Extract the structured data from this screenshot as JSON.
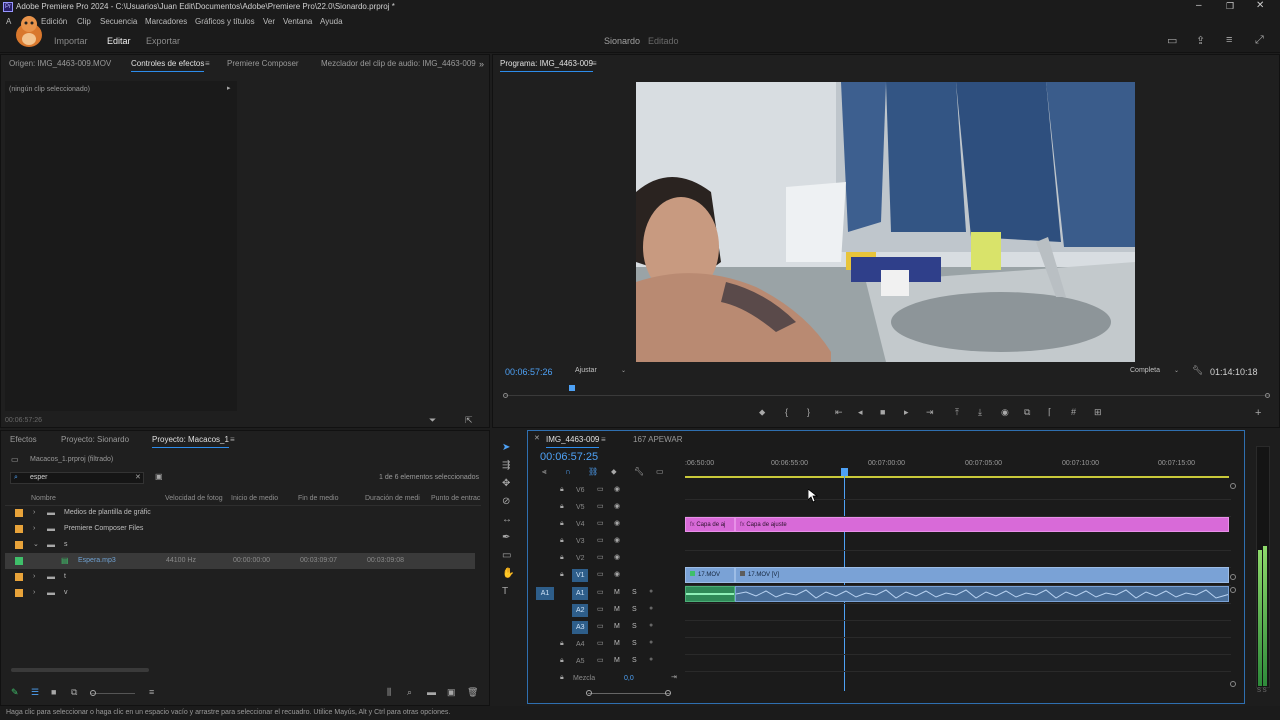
{
  "window": {
    "title": "Adobe Premiere Pro 2024 - C:\\Usuarios\\Juan Edit\\Documentos\\Adobe\\Premiere Pro\\22.0\\Sionardo.prproj *"
  },
  "menu": [
    "A",
    "Edición",
    "Clip",
    "Secuencia",
    "Marcadores",
    "Gráficos y títulos",
    "Ver",
    "Ventana",
    "Ayuda"
  ],
  "workspace": {
    "tabs": [
      "Importar",
      "Editar",
      "Exportar"
    ],
    "active_tab": "Editar",
    "project_name": "Sionardo",
    "project_status": "Editado"
  },
  "source_panel": {
    "tabs": [
      "Origen: IMG_4463-009.MOV",
      "Controles de efectos",
      "Premiere Composer",
      "Mezclador del clip de audio: IMG_4463-009"
    ],
    "no_clip_text": "(ningún clip seleccionado)",
    "timecode": "00:06:57:26"
  },
  "program_panel": {
    "title": "Programa: IMG_4463-009",
    "timecode": "00:06:57:26",
    "fit": "Ajustar",
    "quality": "Completa",
    "duration": "01:14:10:18"
  },
  "project_panel": {
    "tabs": [
      "Efectos",
      "Proyecto: Sionardo",
      "Proyecto: Macacos_1"
    ],
    "path": "Macacos_1.prproj (filtrado)",
    "search_value": "esper",
    "selection_count": "1 de 6 elementos seleccionados",
    "columns": [
      "Nombre",
      "Velocidad de fotog",
      "Inicio de medio",
      "Fin de medio",
      "Duración de medi",
      "Punto de entrac"
    ],
    "rows": [
      {
        "name": "Medios de plantilla de gráfic",
        "type": "folder",
        "color": "#e8a33a"
      },
      {
        "name": "Premiere Composer Files",
        "type": "folder",
        "color": "#e8a33a"
      },
      {
        "name": "s",
        "type": "folder-open",
        "color": "#e8a33a"
      },
      {
        "name": "Espera.mp3",
        "type": "audio",
        "color": "#3fbf6a",
        "rate": "44100 Hz",
        "start": "00:00:00:00",
        "end": "00:03:09:07",
        "duration": "00:03:09:08"
      },
      {
        "name": "t",
        "type": "folder",
        "color": "#e8a33a"
      },
      {
        "name": "v",
        "type": "folder",
        "color": "#e8a33a"
      }
    ]
  },
  "timeline": {
    "tabs": [
      "IMG_4463-009",
      "167 APEWAR"
    ],
    "timecode": "00:06:57:25",
    "ruler": [
      ":06:50:00",
      "00:06:55:00",
      "00:07:00:00",
      "00:07:05:00",
      "00:07:10:00",
      "00:07:15:00"
    ],
    "video_tracks": [
      "V6",
      "V5",
      "V4",
      "V3",
      "V2",
      "V1"
    ],
    "audio_tracks": [
      "A1",
      "A2",
      "A3",
      "A4",
      "A5"
    ],
    "source_patch": "A1",
    "mix_label": "Mezcla",
    "mix_value": "0,0",
    "clips": {
      "adj1": "Capa de aj",
      "adj2": "Capa de ajuste",
      "v1a": "17.MOV",
      "v1b": "17.MOV [V]"
    }
  },
  "meter": {
    "labels": "S S"
  },
  "status_bar": "Haga clic para seleccionar o haga clic en un espacio vacío y arrastre para seleccionar el recuadro. Utilice Mayús, Alt y Ctrl para otras opciones."
}
